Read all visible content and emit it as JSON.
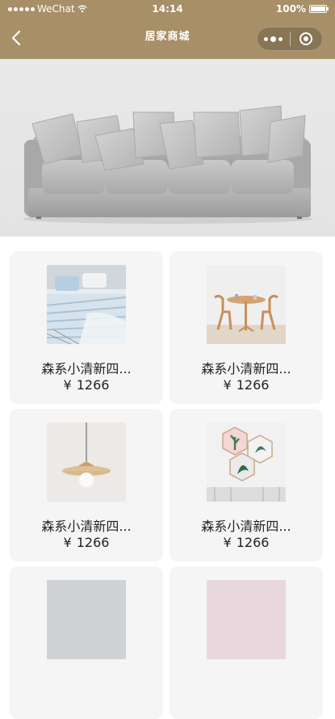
{
  "status_bar": {
    "carrier": "WeChat",
    "time": "14:14",
    "battery": "100%"
  },
  "nav": {
    "title": "居家商城"
  },
  "products": [
    {
      "name": "森系小清新四...",
      "currency": "¥",
      "price": "1266",
      "image": "bedding"
    },
    {
      "name": "森系小清新四...",
      "currency": "¥",
      "price": "1266",
      "image": "dining-table"
    },
    {
      "name": "森系小清新四...",
      "currency": "¥",
      "price": "1266",
      "image": "pendant-lamp"
    },
    {
      "name": "森系小清新四...",
      "currency": "¥",
      "price": "1266",
      "image": "hexagon-wall-art"
    }
  ],
  "colors": {
    "header": "#a78f67",
    "card": "#f5f5f5"
  }
}
